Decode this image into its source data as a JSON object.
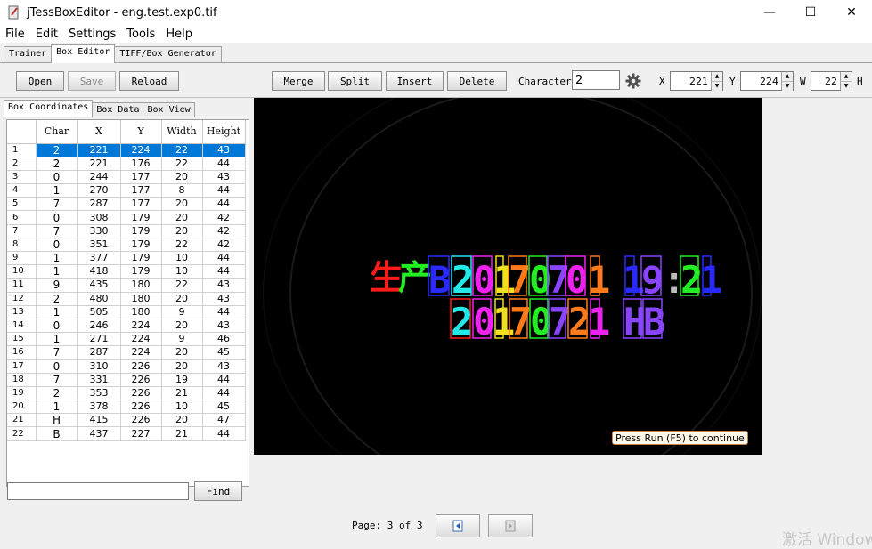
{
  "window": {
    "title": "jTessBoxEditor - eng.test.exp0.tif",
    "minimize": "—",
    "maximize": "☐",
    "close": "✕"
  },
  "menu": [
    "File",
    "Edit",
    "Settings",
    "Tools",
    "Help"
  ],
  "main_tabs": [
    "Trainer",
    "Box Editor",
    "TIFF/Box Generator"
  ],
  "toolbar": {
    "open": "Open",
    "save": "Save",
    "reload": "Reload",
    "merge": "Merge",
    "split": "Split",
    "insert": "Insert",
    "delete": "Delete",
    "character_label": "Character",
    "character_value": "2",
    "x_label": "X",
    "x_value": "221",
    "y_label": "Y",
    "y_value": "224",
    "w_label": "W",
    "w_value": "22",
    "h_label": "H"
  },
  "sub_tabs": [
    "Box Coordinates",
    "Box Data",
    "Box View"
  ],
  "table": {
    "columns": [
      "Char",
      "X",
      "Y",
      "Width",
      "Height"
    ],
    "rows": [
      [
        "1",
        "2",
        "221",
        "224",
        "22",
        "43"
      ],
      [
        "2",
        "2",
        "221",
        "176",
        "22",
        "44"
      ],
      [
        "3",
        "0",
        "244",
        "177",
        "20",
        "43"
      ],
      [
        "4",
        "1",
        "270",
        "177",
        "8",
        "44"
      ],
      [
        "5",
        "7",
        "287",
        "177",
        "20",
        "44"
      ],
      [
        "6",
        "0",
        "308",
        "179",
        "20",
        "42"
      ],
      [
        "7",
        "7",
        "330",
        "179",
        "20",
        "42"
      ],
      [
        "8",
        "0",
        "351",
        "179",
        "22",
        "42"
      ],
      [
        "9",
        "1",
        "377",
        "179",
        "10",
        "44"
      ],
      [
        "10",
        "1",
        "418",
        "179",
        "10",
        "44"
      ],
      [
        "11",
        "9",
        "435",
        "180",
        "22",
        "43"
      ],
      [
        "12",
        "2",
        "480",
        "180",
        "20",
        "43"
      ],
      [
        "13",
        "1",
        "505",
        "180",
        "9",
        "44"
      ],
      [
        "14",
        "0",
        "246",
        "224",
        "20",
        "43"
      ],
      [
        "15",
        "1",
        "271",
        "224",
        "9",
        "46"
      ],
      [
        "16",
        "7",
        "287",
        "224",
        "20",
        "45"
      ],
      [
        "17",
        "0",
        "310",
        "226",
        "20",
        "43"
      ],
      [
        "18",
        "7",
        "331",
        "226",
        "19",
        "44"
      ],
      [
        "19",
        "2",
        "353",
        "226",
        "21",
        "44"
      ],
      [
        "20",
        "1",
        "378",
        "226",
        "10",
        "45"
      ],
      [
        "21",
        "H",
        "415",
        "226",
        "20",
        "47"
      ],
      [
        "22",
        "B",
        "437",
        "227",
        "21",
        "44"
      ]
    ],
    "selected_row": 0
  },
  "find": {
    "value": "",
    "button": "Find"
  },
  "viewer": {
    "line1_prefix": "生产",
    "line1_boxes": [
      "B",
      "2",
      "0",
      "1",
      "7",
      "0",
      "7",
      "0",
      "1",
      "1",
      "9",
      ":",
      "2",
      "1"
    ],
    "line2_boxes": [
      "2",
      "0",
      "1",
      "7",
      "0",
      "7",
      "2",
      "1",
      "H",
      "B"
    ],
    "tooltip": "Press Run (F5) to continue"
  },
  "footer": {
    "page_label": "Page:",
    "page_current": "3",
    "page_of": "of",
    "page_total": "3"
  },
  "watermark": "激活 Windows",
  "colors": {
    "selection": "#0078d7",
    "box_red": "#ff1a1a",
    "box_green": "#22ee22",
    "box_blue": "#2a2aff",
    "box_cyan": "#22e8e8",
    "box_magenta": "#ee22ee",
    "box_yellow": "#f0e020",
    "box_orange": "#ff7a1a",
    "box_purple": "#8844ff"
  }
}
